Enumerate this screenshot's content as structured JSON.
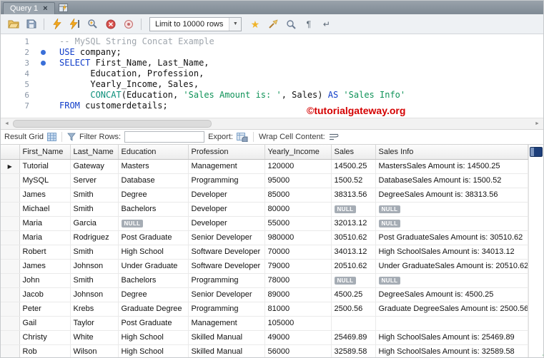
{
  "tab_bar": {
    "tab_label": "Query 1",
    "close_glyph": "×"
  },
  "toolbar": {
    "limit_dropdown_value": "Limit to 10000 rows",
    "dropdown_arrow": "▼"
  },
  "icons": {
    "star": "★",
    "plus": "+",
    "invisibles": "¶",
    "wrap": "↵",
    "scroll_left": "◄",
    "scroll_right": "►"
  },
  "editor": {
    "lines": [
      {
        "num": "1",
        "dot": false,
        "segments": [
          {
            "c": "comment",
            "t": "-- MySQL String Concat Example"
          }
        ]
      },
      {
        "num": "2",
        "dot": true,
        "segments": [
          {
            "c": "kw",
            "t": "USE"
          },
          {
            "c": "pl",
            "t": " company;"
          }
        ]
      },
      {
        "num": "3",
        "dot": true,
        "segments": [
          {
            "c": "kw",
            "t": "SELECT"
          },
          {
            "c": "pl",
            "t": " First_Name, Last_Name,"
          }
        ]
      },
      {
        "num": "4",
        "dot": false,
        "segments": [
          {
            "c": "pl",
            "t": "      Education, Profession,"
          }
        ]
      },
      {
        "num": "5",
        "dot": false,
        "segments": [
          {
            "c": "pl",
            "t": "      Yearly_Income, Sales,"
          }
        ]
      },
      {
        "num": "6",
        "dot": false,
        "segments": [
          {
            "c": "pl",
            "t": "      "
          },
          {
            "c": "fn",
            "t": "CONCAT"
          },
          {
            "c": "pl",
            "t": "(Education, "
          },
          {
            "c": "str",
            "t": "'Sales Amount is: '"
          },
          {
            "c": "pl",
            "t": ", Sales) "
          },
          {
            "c": "kw",
            "t": "AS"
          },
          {
            "c": "pl",
            "t": " "
          },
          {
            "c": "str",
            "t": "'Sales Info'"
          }
        ]
      },
      {
        "num": "7",
        "dot": false,
        "segments": [
          {
            "c": "kw",
            "t": "FROM"
          },
          {
            "c": "pl",
            "t": " customerdetails;"
          }
        ]
      }
    ]
  },
  "watermark": "©tutorialgateway.org",
  "result_toolbar": {
    "result_grid_label": "Result Grid",
    "filter_label": "Filter Rows:",
    "filter_value": "",
    "export_label": "Export:",
    "wrap_label": "Wrap Cell Content:"
  },
  "grid": {
    "null_label": "NULL",
    "row_marker": "▶",
    "columns": [
      "First_Name",
      "Last_Name",
      "Education",
      "Profession",
      "Yearly_Income",
      "Sales",
      "Sales Info"
    ],
    "rows": [
      [
        "Tutorial",
        "Gateway",
        "Masters",
        "Management",
        "120000",
        "14500.25",
        "MastersSales Amount is: 14500.25"
      ],
      [
        "MySQL",
        "Server",
        "Database",
        "Programming",
        "95000",
        "1500.52",
        "DatabaseSales Amount is: 1500.52"
      ],
      [
        "James",
        "Smith",
        "Degree",
        "Developer",
        "85000",
        "38313.56",
        "DegreeSales Amount is: 38313.56"
      ],
      [
        "Michael",
        "Smith",
        "Bachelors",
        "Developer",
        "80000",
        null,
        null
      ],
      [
        "Maria",
        "Garcia",
        null,
        "Developer",
        "55000",
        "32013.12",
        null
      ],
      [
        "Maria",
        "Rodriguez",
        "Post Graduate",
        "Senior Developer",
        "980000",
        "30510.62",
        "Post GraduateSales Amount is: 30510.62"
      ],
      [
        "Robert",
        "Smith",
        "High School",
        "Software Developer",
        "70000",
        "34013.12",
        "High SchoolSales Amount is: 34013.12"
      ],
      [
        "James",
        "Johnson",
        "Under Graduate",
        "Software Developer",
        "79000",
        "20510.62",
        "Under GraduateSales Amount is: 20510.62"
      ],
      [
        "John",
        "Smith",
        "Bachelors",
        "Programming",
        "78000",
        null,
        null
      ],
      [
        "Jacob",
        "Johnson",
        "Degree",
        "Senior Developer",
        "89000",
        "4500.25",
        "DegreeSales Amount is: 4500.25"
      ],
      [
        "Peter",
        "Krebs",
        "Graduate Degree",
        "Programming",
        "81000",
        "2500.56",
        "Graduate DegreeSales Amount is: 2500.56"
      ],
      [
        "Gail",
        "Taylor",
        "Post Graduate",
        "Management",
        "105000",
        "",
        ""
      ],
      [
        "Christy",
        "White",
        "High School",
        "Skilled Manual",
        "49000",
        "25469.89",
        "High SchoolSales Amount is: 25469.89"
      ],
      [
        "Rob",
        "Wilson",
        "High School",
        "Skilled Manual",
        "56000",
        "32589.58",
        "High SchoolSales Amount is: 32589.58"
      ]
    ]
  }
}
